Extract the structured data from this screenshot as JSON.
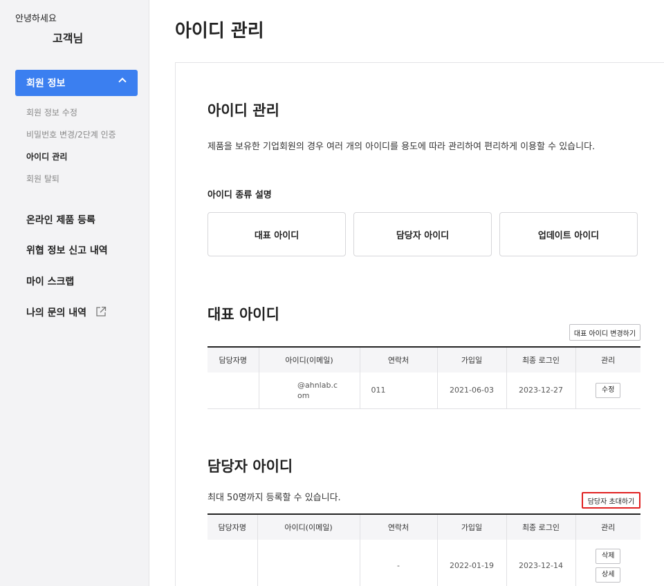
{
  "sidebar": {
    "greeting": "안녕하세요",
    "user_name": "고객님",
    "active_menu": "회원 정보",
    "submenu": [
      "회원 정보 수정",
      "비밀번호 변경/2단계 인증",
      "아이디 관리",
      "회원 탈퇴"
    ],
    "menus": [
      "온라인 제품 등록",
      "위협 정보 신고 내역",
      "마이 스크랩",
      "나의 문의 내역"
    ]
  },
  "page": {
    "title": "아이디 관리"
  },
  "section_intro": {
    "title": "아이디 관리",
    "description": "제품을 보유한 기업회원의 경우 여러 개의 아이디를 용도에 따라 관리하여 편리하게 이용할 수 있습니다.",
    "types_heading": "아이디 종류 설명",
    "types": [
      "대표 아이디",
      "담당자 아이디",
      "업데이트 아이디"
    ]
  },
  "main_id": {
    "title": "대표 아이디",
    "change_button": "대표 아이디 변경하기",
    "columns": [
      "담당자명",
      "아이디(이메일)",
      "연락처",
      "가입일",
      "최종 로그인",
      "관리"
    ],
    "row": {
      "name": "",
      "email": "@ahnlab.com",
      "phone": "011",
      "joined": "2021-06-03",
      "last_login": "2023-12-27",
      "action": "수정"
    }
  },
  "manager_id": {
    "title": "담당자 아이디",
    "note": "최대 50명까지 등록할 수 있습니다.",
    "invite_button": "담당자 초대하기",
    "columns": [
      "담당자명",
      "아이디(이메일)",
      "연락처",
      "가입일",
      "최종 로그인",
      "관리"
    ],
    "row": {
      "name": "",
      "email": "",
      "phone": "-",
      "joined": "2022-01-19",
      "last_login": "2023-12-14",
      "action_delete": "삭제",
      "action_detail": "상세"
    }
  },
  "colors": {
    "accent": "#3b7ff0",
    "highlight": "#e02020"
  }
}
